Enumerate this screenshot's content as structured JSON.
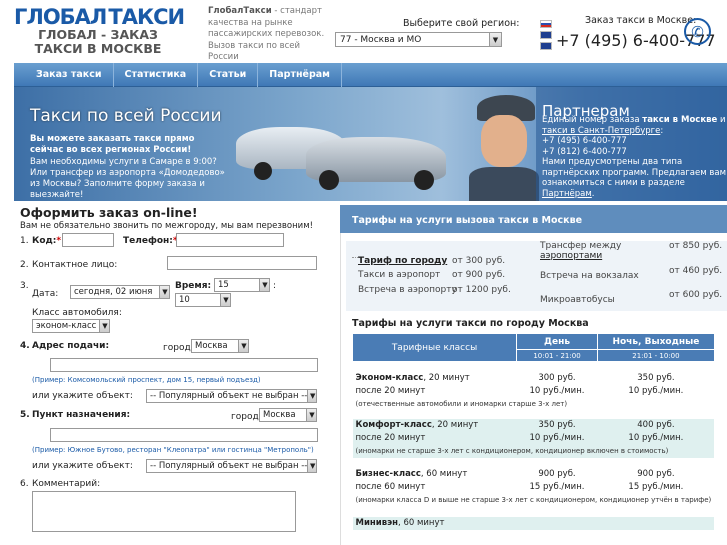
{
  "header": {
    "logo_left": "ГЛОБАЛ",
    "logo_right": "ТАКСИ",
    "logo_sub": "ГЛОБАЛ - ЗАКАЗ ТАКСИ В МОСКВЕ",
    "slogan_brand": "ГлобалТакси",
    "slogan_rest": " - стандарт качества на рынке пассажирских перевозок.",
    "slogan_line2": "Вызов такси по всей России",
    "region_label": "Выберите свой регион:",
    "region_value": "77 - Москва и МО",
    "order_label": "Заказ такси в Москве:",
    "phone": "+7 (495) 6-400-777"
  },
  "nav": [
    "Заказ такси",
    "Статистика",
    "Статьи",
    "Партнёрам"
  ],
  "banner": {
    "title": "Такси по всей России",
    "bold_text": "Вы можете заказать такси прямо сейчас во всех регионах России!",
    "text": "Вам необходимы услуги в Самаре в 9:00? Или трансфер из аэропорта «Домодедово» из Москвы? Заполните форму заказа и выезжайте!",
    "partner_title": "Партнерам",
    "partner_l1": "Единый номер заказа ",
    "partner_b1": "такси в Москве",
    "partner_l2": " и ",
    "partner_link1": "такси в Санкт-Петербурге",
    "partner_l3": ":",
    "partner_phone1": "+7 (495) 6-400-777",
    "partner_phone2": "+7 (812) 6-400-777",
    "partner_l4": "Нами предусмотрены два типа партнёрских программ. Предлагаем вам ознакомиться с ними в разделе ",
    "partner_link2": "Партнёрам",
    "partner_l5": "."
  },
  "form": {
    "title": "Оформить заказ on-line!",
    "note": "Вам не обязательно звонить по межгороду, мы вам перезвоним!",
    "n1": "1.",
    "code_label": "Код:",
    "phone_label": "Телефон:",
    "n2": "2.",
    "contact_label": "Контактное лицо:",
    "n3": "3.",
    "date_label": "Дата:",
    "date_value": "сегодня, 02 июня",
    "time_label": "Время:",
    "hour": "15",
    "colon": ":",
    "minute": "10",
    "class_label": "Класс автомобиля:",
    "class_value": "эконом-класс",
    "n4": "4.",
    "pickup_label": "Адрес подачи:",
    "city_label": "город",
    "city_value": "Москва",
    "pickup_hint": "(Пример: Комсомольский проспект, дом 15, первый подъезд)",
    "or_object": "или укажите объект:",
    "object_value": "-- Популярный объект не выбран --",
    "n5": "5.",
    "dest_label": "Пункт назначения:",
    "dest_hint": "(Пример: Южное Бутово, ресторан \"Клеопатра\" или гостинца \"Метрополь\")",
    "n6": "6.",
    "comment_label": "Комментарий:"
  },
  "tariffs": {
    "title": "Тарифы на услуги вызова такси в Москве",
    "left": [
      {
        "name": "Тариф по городу",
        "price": "от    300 руб."
      },
      {
        "name": "Такси в аэропорт",
        "price": "от    900 руб."
      },
      {
        "name": "Встреча в аэропорту",
        "price": "от 1200 руб."
      }
    ],
    "right": [
      {
        "name": "Трансфер между ",
        "link": "аэропортами",
        "price": "от 850 руб."
      },
      {
        "name": "Встреча на вокзалах",
        "price": "от 460 руб."
      },
      {
        "name": "Микроавтобусы",
        "price": "от 600 руб."
      }
    ],
    "city_title": "Тарифы на услуги такси по городу Москва",
    "col_class": "Тарифные классы",
    "col_day": "День",
    "col_day_time": "10:01 - 21:00",
    "col_night": "Ночь, Выходные",
    "col_night_time": "21:01 - 10:00",
    "rows": [
      {
        "cls": "Эконом-класс",
        "mins": ", 20 минут",
        "day": "300 руб.",
        "night": "350 руб.",
        "after": "после 20 минут",
        "day2": "10 руб./мин.",
        "night2": "10 руб./мин.",
        "note": "(отечественные автомобили и иномарки старше 3-х лет)"
      },
      {
        "cls": "Комфорт-класс",
        "mins": ", 20 минут",
        "day": "350 руб.",
        "night": "400 руб.",
        "after": "после 20 минут",
        "day2": "10 руб./мин.",
        "night2": "10 руб./мин.",
        "note": "(иномарки не старше 3-х лет с кондиционером, кондиционер включен в стоимость)"
      },
      {
        "cls": "Бизнес-класс",
        "mins": ", 60 минут",
        "day": "900 руб.",
        "night": "900 руб.",
        "after": "после 60 минут",
        "day2": "15 руб./мин.",
        "night2": "15 руб./мин.",
        "note": "(иномарки класса D и выше не старше 3-х лет с кондиционером, кондиционер утчён в тарифе)"
      },
      {
        "cls": "Минивэн",
        "mins": ", 60 минут",
        "day": "",
        "night": "",
        "after": "",
        "day2": "",
        "night2": "",
        "note": ""
      }
    ]
  },
  "colors": {
    "brand": "#1a5aa7",
    "nav": "#4a7cb5",
    "teal_row": "#dff0ef"
  }
}
